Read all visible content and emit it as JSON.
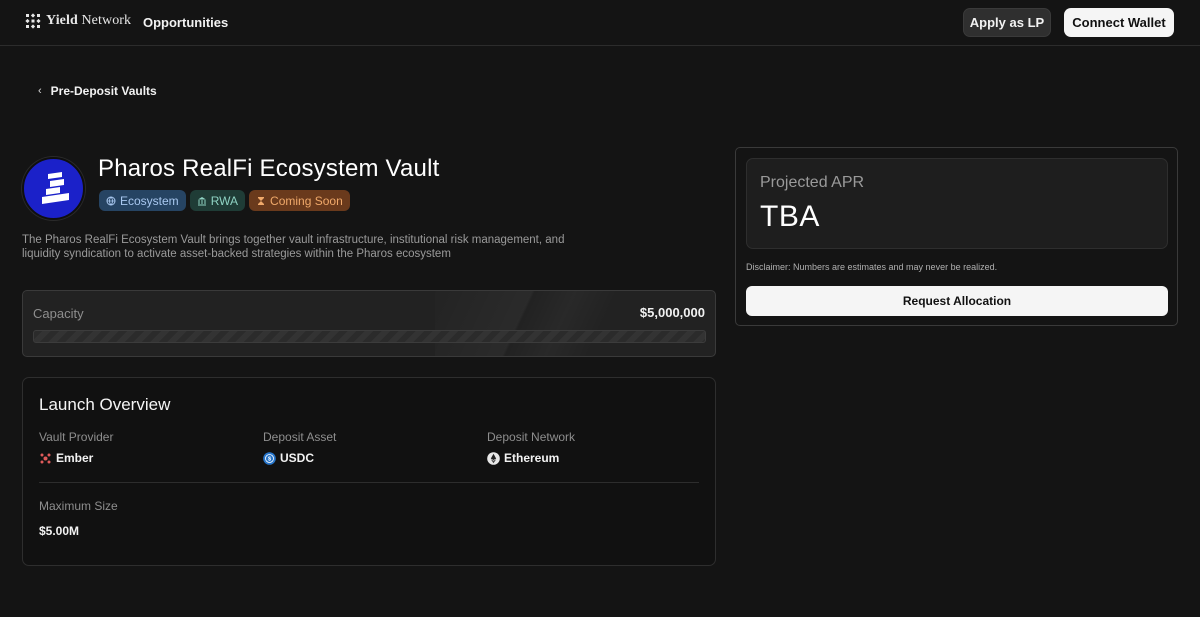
{
  "header": {
    "brand": "Yield Network",
    "brand_bold": "Yield",
    "brand_rest": " Network",
    "nav_opportunities": "Opportunities",
    "apply_lp_label": "Apply as LP",
    "connect_wallet_label": "Connect Wallet"
  },
  "breadcrumb": {
    "icon": "chevron-left-icon",
    "label": "Pre-Deposit Vaults"
  },
  "vault": {
    "title": "Pharos RealFi Ecosystem Vault",
    "tags": [
      {
        "label": "Ecosystem",
        "icon": "globe-icon",
        "color": "#264463"
      },
      {
        "label": "RWA",
        "icon": "bank-icon",
        "color": "#1f3c36"
      },
      {
        "label": "Coming Soon",
        "icon": "hourglass-icon",
        "color": "#6a3a1c"
      }
    ],
    "description": "The Pharos RealFi Ecosystem Vault brings together vault infrastructure, institutional risk management, and liquidity syndication to activate asset-backed strategies within the Pharos ecosystem",
    "logo_color": "#1b21c9"
  },
  "capacity": {
    "label": "Capacity",
    "value": "$5,000,000",
    "fill_fraction": 0
  },
  "overview": {
    "title": "Launch Overview",
    "vault_provider_label": "Vault Provider",
    "vault_provider_value": "Ember",
    "deposit_asset_label": "Deposit Asset",
    "deposit_asset_value": "USDC",
    "deposit_network_label": "Deposit Network",
    "deposit_network_value": "Ethereum",
    "max_size_label": "Maximum Size",
    "max_size_value": "$5.00M"
  },
  "apr": {
    "label": "Projected APR",
    "value": "TBA",
    "disclaimer": "Disclaimer: Numbers are estimates and may never be realized.",
    "request_label": "Request Allocation"
  },
  "colors": {
    "background": "#141414",
    "primary_button": "#f5f5f5",
    "vault_logo": "#1b21c9"
  }
}
